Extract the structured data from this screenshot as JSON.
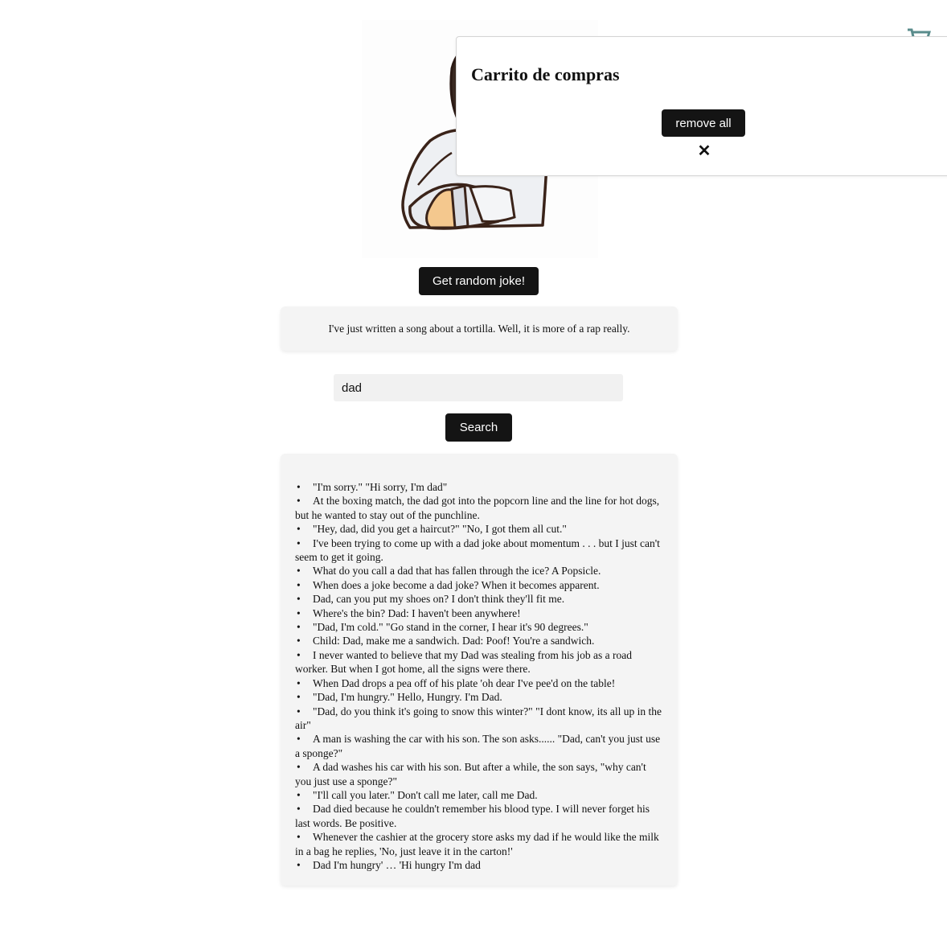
{
  "cart": {
    "icon": "shopping-cart-icon",
    "title": "Carrito de compras",
    "remove_all_label": "remove all",
    "close_label": "✕"
  },
  "hero": {
    "image": "dad-illustration"
  },
  "joke_button_label": "Get random joke!",
  "current_joke": "I've just written a song about a tortilla. Well, it is more of a rap really.",
  "search": {
    "value": "dad",
    "button_label": "Search"
  },
  "results": [
    "\"I'm sorry.\" \"Hi sorry, I'm dad\"",
    "At the boxing match, the dad got into the popcorn line and the line for hot dogs, but he wanted to stay out of the punchline.",
    "\"Hey, dad, did you get a haircut?\" \"No, I got them all cut.\"",
    "I've been trying to come up with a dad joke about momentum . . . but I just can't seem to get it going.",
    "What do you call a dad that has fallen through the ice? A Popsicle.",
    "When does a joke become a dad joke? When it becomes apparent.",
    "Dad, can you put my shoes on? I don't think they'll fit me.",
    "Where's the bin? Dad: I haven't been anywhere!",
    "\"Dad, I'm cold.\" \"Go stand in the corner, I hear it's 90 degrees.\"",
    "Child: Dad, make me a sandwich. Dad: Poof! You're a sandwich.",
    "I never wanted to believe that my Dad was stealing from his job as a road worker. But when I got home, all the signs were there.",
    "When Dad drops a pea off of his plate 'oh dear I've pee'd on the table!",
    "\"Dad, I'm hungry.\" Hello, Hungry. I'm Dad.",
    "\"Dad, do you think it's going to snow this winter?\" \"I dont know, its all up in the air\"",
    "A man is washing the car with his son. The son asks...... \"Dad, can't you just use a sponge?\"",
    "A dad washes his car with his son. But after a while, the son says, \"why can't you just use a sponge?\"",
    "\"I'll call you later.\" Don't call me later, call me Dad.",
    "Dad died because he couldn't remember his blood type. I will never forget his last words. Be positive.",
    "Whenever the cashier at the grocery store asks my dad if he would like the milk in a bag he replies, 'No, just leave it in the carton!'",
    "Dad I'm hungry' … 'Hi hungry I'm dad"
  ]
}
